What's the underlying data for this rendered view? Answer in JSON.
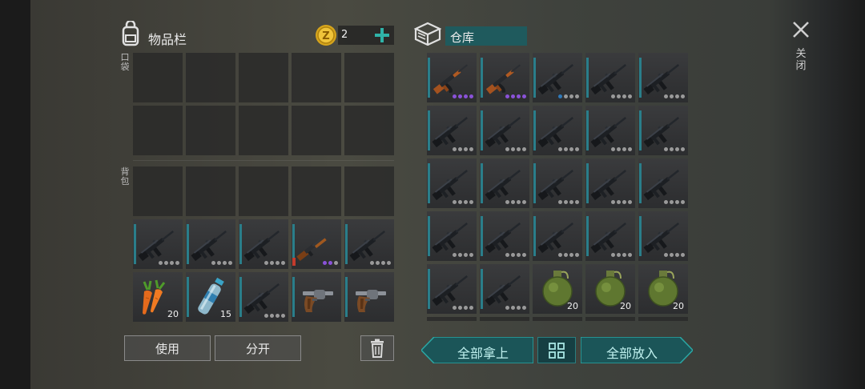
{
  "inventory": {
    "title": "物品栏",
    "coins": "2",
    "pocket_label": "口袋",
    "backpack_label": "背包",
    "use_button": "使用",
    "split_button": "分开"
  },
  "storage": {
    "title": "仓库",
    "take_all_button": "全部拿上",
    "put_all_button": "全部放入"
  },
  "close_label": "关闭",
  "backpack_items": [
    {
      "type": "rifle",
      "dots": [
        "g",
        "g",
        "g",
        "g"
      ]
    },
    {
      "type": "rifle",
      "dots": [
        "g",
        "g",
        "g",
        "g"
      ]
    },
    {
      "type": "rifle",
      "dots": [
        "g",
        "g",
        "g",
        "g"
      ]
    },
    {
      "type": "shotgun",
      "dots": [
        "p",
        "p",
        "g"
      ],
      "red": true
    },
    {
      "type": "rifle",
      "dots": [
        "g",
        "g",
        "g",
        "g"
      ]
    },
    {
      "type": "carrot",
      "count": "20"
    },
    {
      "type": "bottle",
      "count": "15"
    },
    {
      "type": "rifle",
      "dots": [
        "g",
        "g",
        "g",
        "g"
      ]
    },
    {
      "type": "revolver"
    },
    {
      "type": "revolver"
    }
  ],
  "storage_items": [
    {
      "type": "ak",
      "dots": [
        "p",
        "p",
        "p",
        "p"
      ]
    },
    {
      "type": "ak",
      "dots": [
        "p",
        "p",
        "p",
        "p"
      ]
    },
    {
      "type": "rifle",
      "dots": [
        "b",
        "g",
        "g",
        "g"
      ]
    },
    {
      "type": "rifle",
      "dots": [
        "g",
        "g",
        "g",
        "g"
      ]
    },
    {
      "type": "rifle",
      "dots": [
        "g",
        "g",
        "g",
        "g"
      ]
    },
    {
      "type": "rifle",
      "dots": [
        "g",
        "g",
        "g",
        "g"
      ]
    },
    {
      "type": "rifle",
      "dots": [
        "g",
        "g",
        "g",
        "g"
      ]
    },
    {
      "type": "rifle",
      "dots": [
        "g",
        "g",
        "g",
        "g"
      ]
    },
    {
      "type": "rifle",
      "dots": [
        "g",
        "g",
        "g",
        "g"
      ]
    },
    {
      "type": "rifle",
      "dots": [
        "g",
        "g",
        "g",
        "g"
      ]
    },
    {
      "type": "rifle",
      "dots": [
        "g",
        "g",
        "g",
        "g"
      ]
    },
    {
      "type": "rifle",
      "dots": [
        "g",
        "g",
        "g",
        "g"
      ]
    },
    {
      "type": "rifle",
      "dots": [
        "g",
        "g",
        "g",
        "g"
      ]
    },
    {
      "type": "rifle",
      "dots": [
        "g",
        "g",
        "g",
        "g"
      ]
    },
    {
      "type": "rifle",
      "dots": [
        "g",
        "g",
        "g",
        "g"
      ]
    },
    {
      "type": "rifle",
      "dots": [
        "g",
        "g",
        "g",
        "g"
      ]
    },
    {
      "type": "rifle",
      "dots": [
        "g",
        "g",
        "g",
        "g"
      ]
    },
    {
      "type": "rifle",
      "dots": [
        "g",
        "g",
        "g",
        "g"
      ]
    },
    {
      "type": "rifle",
      "dots": [
        "g",
        "g",
        "g",
        "g"
      ]
    },
    {
      "type": "rifle",
      "dots": [
        "g",
        "g",
        "g",
        "g"
      ]
    },
    {
      "type": "rifle",
      "dots": [
        "g",
        "g",
        "g",
        "g"
      ]
    },
    {
      "type": "rifle",
      "dots": [
        "g",
        "g",
        "g",
        "g"
      ]
    },
    {
      "type": "grenade",
      "count": "20"
    },
    {
      "type": "grenade",
      "count": "20"
    },
    {
      "type": "grenade",
      "count": "20"
    }
  ],
  "colors": {
    "accent": "#2a8a8e",
    "rarity_purple": "#8a52d8",
    "rarity_blue": "#2f79b9"
  }
}
